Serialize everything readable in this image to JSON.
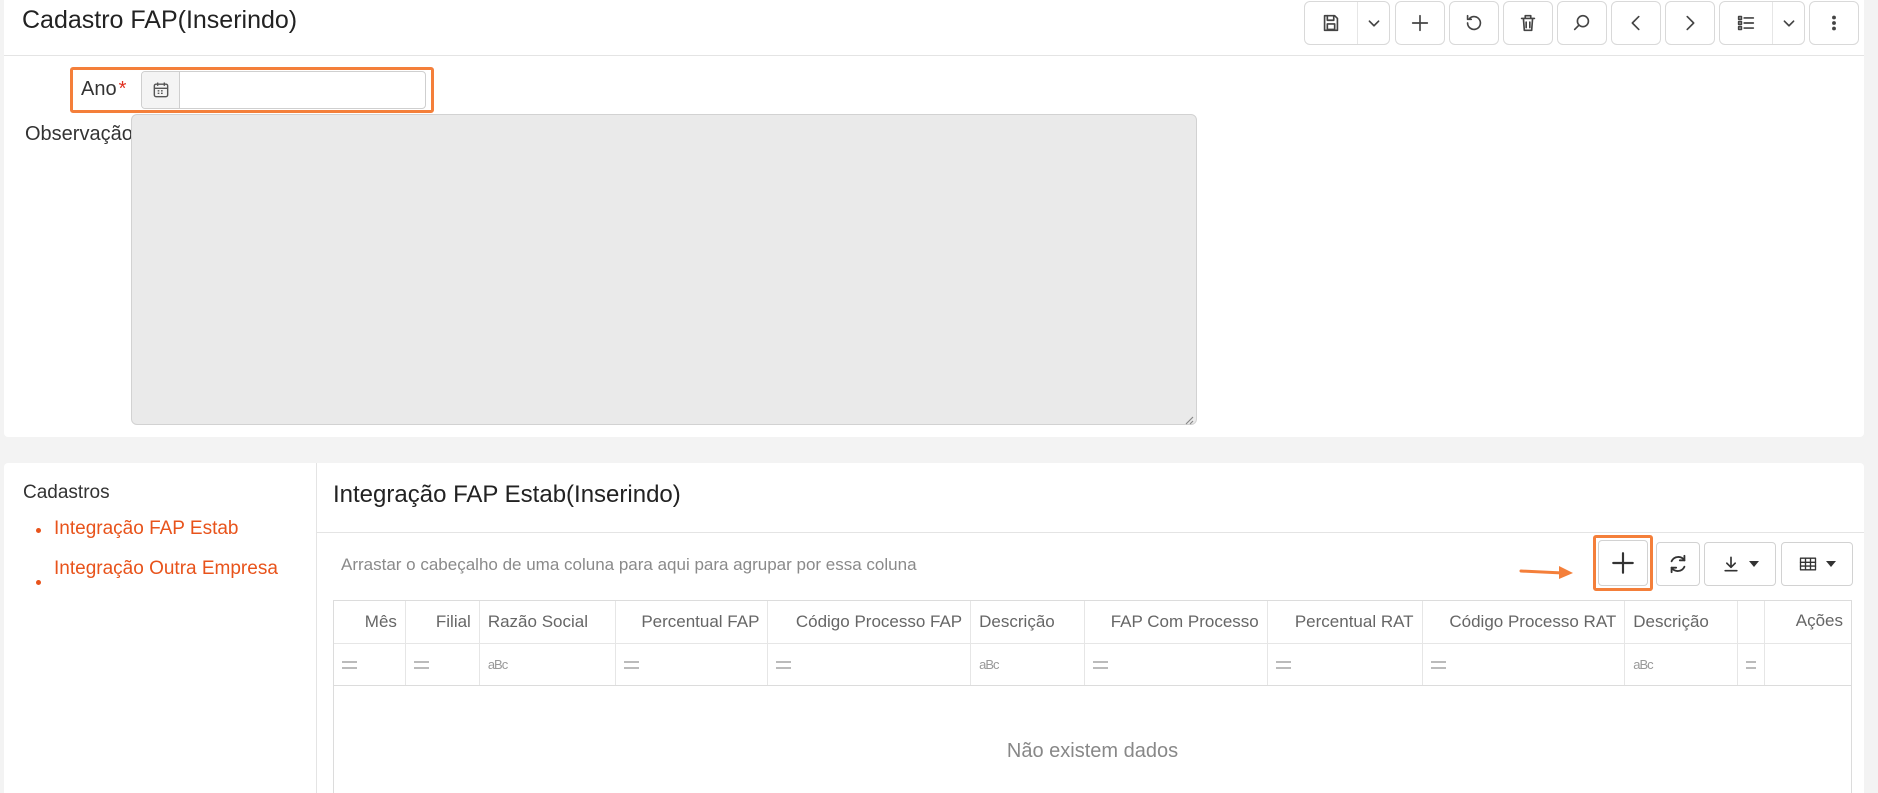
{
  "header": {
    "title": "Cadastro FAP(Inserindo)",
    "toolbar": {
      "save_icon": "floppy-disk-icon",
      "dropdown_icon": "chevron-down-icon",
      "add_icon": "plus-icon",
      "undo_icon": "undo-icon",
      "delete_icon": "trash-icon",
      "search_icon": "search-icon",
      "prev_icon": "chevron-left-icon",
      "next_icon": "chevron-right-icon",
      "list_icon": "list-icon",
      "more_icon": "more-vertical-icon"
    }
  },
  "form": {
    "ano_label": "Ano",
    "ano_required": "*",
    "ano_value": "",
    "observacao_label": "Observação",
    "observacao_value": ""
  },
  "sidebar": {
    "title": "Cadastros",
    "items": [
      {
        "label": "Integração FAP Estab"
      },
      {
        "label": "Integração Outra Empresa"
      }
    ]
  },
  "detail": {
    "title": "Integração FAP Estab(Inserindo)",
    "group_hint": "Arrastar o cabeçalho de uma coluna para aqui para agrupar por essa coluna",
    "columns": [
      {
        "label": "Mês",
        "filter": "equals"
      },
      {
        "label": "Filial",
        "filter": "equals"
      },
      {
        "label": "Razão Social",
        "filter": "contains"
      },
      {
        "label": "Percentual FAP",
        "filter": "equals"
      },
      {
        "label": "Código Processo FAP",
        "filter": "equals"
      },
      {
        "label": "Descrição",
        "filter": "contains"
      },
      {
        "label": "FAP Com Processo",
        "filter": "equals"
      },
      {
        "label": "Percentual RAT",
        "filter": "equals"
      },
      {
        "label": "Código Processo RAT",
        "filter": "equals"
      },
      {
        "label": "Descrição",
        "filter": "contains"
      },
      {
        "label": "",
        "filter": "equals"
      },
      {
        "label": "Ações",
        "filter": ""
      }
    ],
    "contains_icon_text": "aBc",
    "empty_message": "Não existem dados"
  },
  "colors": {
    "accent": "#e8531b",
    "highlight": "#f47f3a",
    "required": "#e03020"
  }
}
